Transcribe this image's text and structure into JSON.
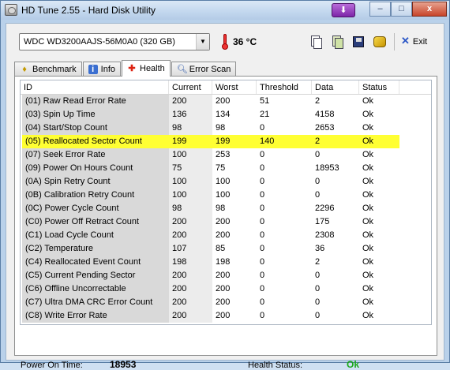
{
  "window": {
    "title": "HD Tune 2.55 - Hard Disk Utility",
    "minimize": "–",
    "maximize": "□",
    "close": "x",
    "extra_button": "⬇"
  },
  "toolbar": {
    "drive": "WDC WD3200AAJS-56M0A0 (320 GB)",
    "temperature": "36 °C",
    "exit_label": "Exit",
    "icons": [
      "copy-info-icon",
      "copy-screenshot-icon",
      "save-icon",
      "options-icon"
    ]
  },
  "tabs": [
    {
      "label": "Benchmark",
      "icon": "benchmark-icon"
    },
    {
      "label": "Info",
      "icon": "info-icon"
    },
    {
      "label": "Health",
      "icon": "health-icon",
      "active": true
    },
    {
      "label": "Error Scan",
      "icon": "error-scan-icon"
    }
  ],
  "table": {
    "columns": [
      "ID",
      "Current",
      "Worst",
      "Threshold",
      "Data",
      "Status"
    ],
    "rows": [
      {
        "id": "(01) Raw Read Error Rate",
        "current": "200",
        "worst": "200",
        "threshold": "51",
        "data": "2",
        "status": "Ok"
      },
      {
        "id": "(03) Spin Up Time",
        "current": "136",
        "worst": "134",
        "threshold": "21",
        "data": "4158",
        "status": "Ok"
      },
      {
        "id": "(04) Start/Stop Count",
        "current": "98",
        "worst": "98",
        "threshold": "0",
        "data": "2653",
        "status": "Ok"
      },
      {
        "id": "(05) Reallocated Sector Count",
        "current": "199",
        "worst": "199",
        "threshold": "140",
        "data": "2",
        "status": "Ok",
        "highlight": true
      },
      {
        "id": "(07) Seek Error Rate",
        "current": "100",
        "worst": "253",
        "threshold": "0",
        "data": "0",
        "status": "Ok"
      },
      {
        "id": "(09) Power On Hours Count",
        "current": "75",
        "worst": "75",
        "threshold": "0",
        "data": "18953",
        "status": "Ok"
      },
      {
        "id": "(0A) Spin Retry Count",
        "current": "100",
        "worst": "100",
        "threshold": "0",
        "data": "0",
        "status": "Ok"
      },
      {
        "id": "(0B) Calibration Retry Count",
        "current": "100",
        "worst": "100",
        "threshold": "0",
        "data": "0",
        "status": "Ok"
      },
      {
        "id": "(0C) Power Cycle Count",
        "current": "98",
        "worst": "98",
        "threshold": "0",
        "data": "2296",
        "status": "Ok"
      },
      {
        "id": "(C0) Power Off Retract Count",
        "current": "200",
        "worst": "200",
        "threshold": "0",
        "data": "175",
        "status": "Ok"
      },
      {
        "id": "(C1) Load Cycle Count",
        "current": "200",
        "worst": "200",
        "threshold": "0",
        "data": "2308",
        "status": "Ok"
      },
      {
        "id": "(C2) Temperature",
        "current": "107",
        "worst": "85",
        "threshold": "0",
        "data": "36",
        "status": "Ok"
      },
      {
        "id": "(C4) Reallocated Event Count",
        "current": "198",
        "worst": "198",
        "threshold": "0",
        "data": "2",
        "status": "Ok"
      },
      {
        "id": "(C5) Current Pending Sector",
        "current": "200",
        "worst": "200",
        "threshold": "0",
        "data": "0",
        "status": "Ok"
      },
      {
        "id": "(C6) Offline Uncorrectable",
        "current": "200",
        "worst": "200",
        "threshold": "0",
        "data": "0",
        "status": "Ok"
      },
      {
        "id": "(C7) Ultra DMA CRC Error Count",
        "current": "200",
        "worst": "200",
        "threshold": "0",
        "data": "0",
        "status": "Ok"
      },
      {
        "id": "(C8) Write Error Rate",
        "current": "200",
        "worst": "200",
        "threshold": "0",
        "data": "0",
        "status": "Ok"
      }
    ]
  },
  "footer": {
    "power_on_label": "Power On Time:",
    "power_on_value": "18953",
    "health_label": "Health Status:",
    "health_value": "Ok",
    "health_color": "#18a818"
  },
  "colors": {
    "highlight": "#ffff33"
  }
}
